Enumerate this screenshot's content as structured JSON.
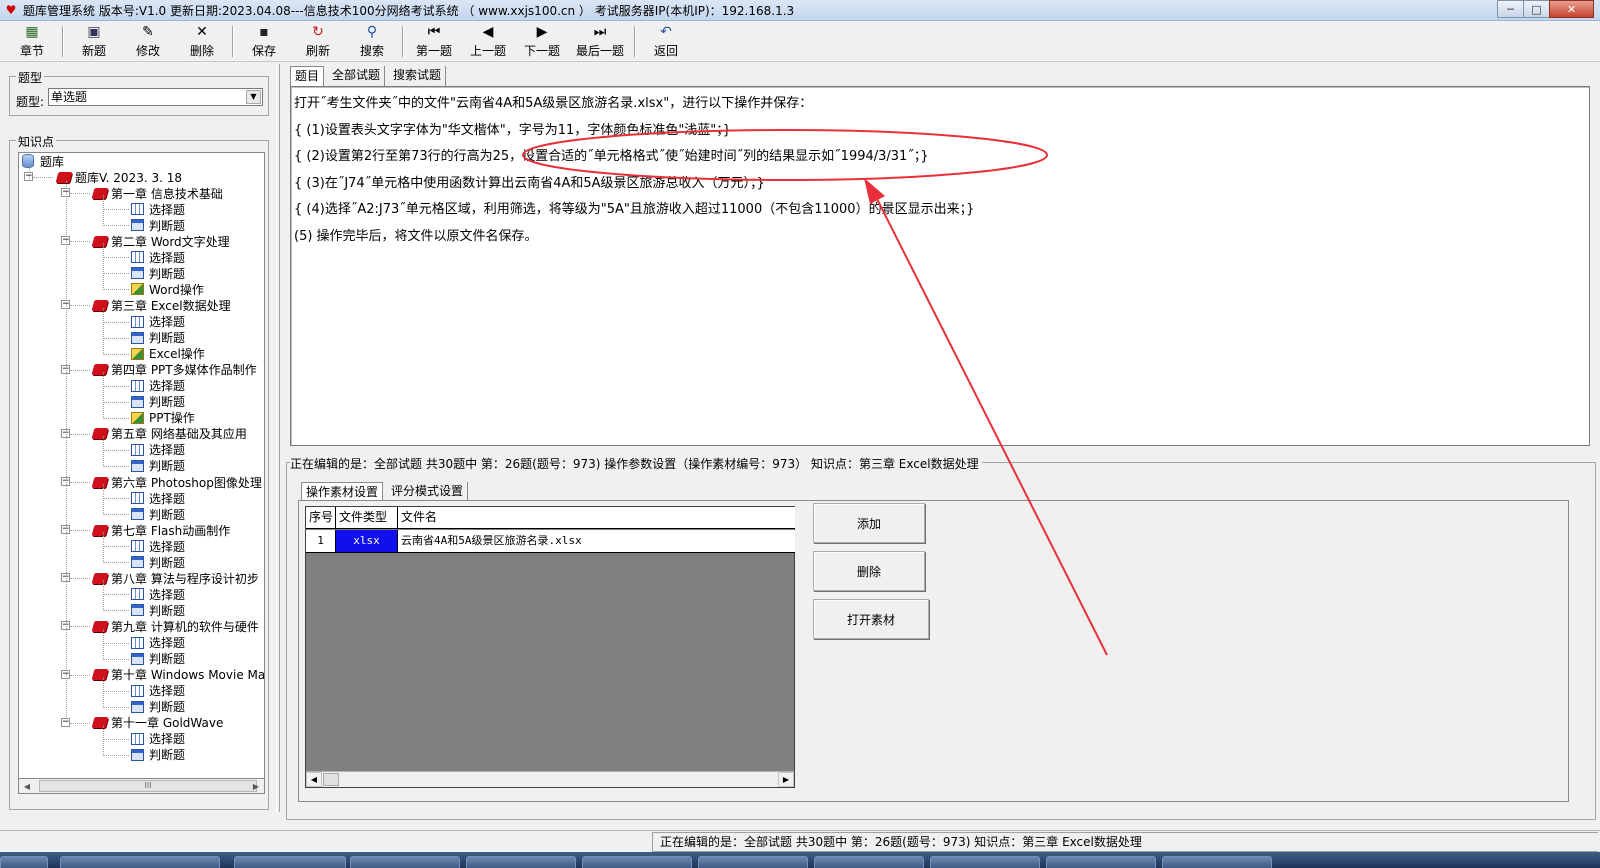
{
  "window": {
    "title": "题库管理系统 版本号:V1.0 更新日期:2023.04.08---信息技术100分网络考试系统  （ www.xxjs100.cn ）   考试服务器IP(本机IP)：192.168.1.3",
    "controls": {
      "minimize": "─",
      "maximize": "□",
      "close": "✕"
    }
  },
  "toolbar": [
    {
      "label": "章节",
      "icon": "chapter-icon"
    },
    {
      "label": "新题",
      "icon": "new-icon"
    },
    {
      "label": "修改",
      "icon": "edit-icon"
    },
    {
      "label": "删除",
      "icon": "delete-icon"
    },
    {
      "label": "保存",
      "icon": "save-icon"
    },
    {
      "label": "刷新",
      "icon": "refresh-icon"
    },
    {
      "label": "搜索",
      "icon": "search-icon"
    },
    {
      "label": "第一题",
      "icon": "first-icon"
    },
    {
      "label": "上一题",
      "icon": "prev-icon"
    },
    {
      "label": "下一题",
      "icon": "next-icon"
    },
    {
      "label": "最后一题",
      "icon": "last-icon"
    },
    {
      "label": "返回",
      "icon": "back-icon"
    }
  ],
  "left": {
    "type_group_title": "题型",
    "type_label": "题型:",
    "type_value": "单选题",
    "knowledge_group_title": "知识点",
    "tree": {
      "root": "题库",
      "db": "题库V. 2023. 3. 18",
      "chapters": [
        {
          "name": "第一章 信息技术基础",
          "children": [
            "选择题",
            "判断题"
          ]
        },
        {
          "name": "第二章 Word文字处理",
          "children": [
            "选择题",
            "判断题",
            "Word操作"
          ]
        },
        {
          "name": "第三章 Excel数据处理",
          "children": [
            "选择题",
            "判断题",
            "Excel操作"
          ]
        },
        {
          "name": "第四章 PPT多媒体作品制作",
          "children": [
            "选择题",
            "判断题",
            "PPT操作"
          ]
        },
        {
          "name": "第五章 网络基础及其应用",
          "children": [
            "选择题",
            "判断题"
          ]
        },
        {
          "name": "第六章 Photoshop图像处理",
          "children": [
            "选择题",
            "判断题"
          ]
        },
        {
          "name": "第七章 Flash动画制作",
          "children": [
            "选择题",
            "判断题"
          ]
        },
        {
          "name": "第八章 算法与程序设计初步",
          "children": [
            "选择题",
            "判断题"
          ]
        },
        {
          "name": "第九章 计算机的软件与硬件",
          "children": [
            "选择题",
            "判断题"
          ]
        },
        {
          "name": "第十章 Windows Movie Make",
          "children": [
            "选择题",
            "判断题"
          ]
        },
        {
          "name": "第十一章 GoldWave",
          "children": [
            "选择题",
            "判断题"
          ]
        }
      ]
    },
    "hscroll_thumb": "III"
  },
  "tabs": [
    "题目",
    "全部试题",
    "搜索试题"
  ],
  "question": {
    "lines": [
      "打开˝考生文件夹˝中的文件\"云南省4A和5A级景区旅游名录.xlsx\"，进行以下操作并保存：",
      "{ (1)设置表头文字字体为\"华文楷体\"，字号为11，字体颜色标准色\"浅蓝\"；}",
      "{ (2)设置第2行至第73行的行高为25，设置合适的˝单元格格式˝使˝始建时间˝列的结果显示如˝1994/3/31˝；}",
      "{ (3)在˝J74˝单元格中使用函数计算出云南省4A和5A级景区旅游总收入（万元）；}",
      "{ (4)选择˝A2:J73˝单元格区域，利用筛选，将等级为\"5A\"且旅游收入超过11000（不包含11000）的景区显示出来；}",
      "(5) 操作完毕后，将文件以原文件名保存。"
    ]
  },
  "edit_status": "正在编辑的是：全部试题 共30题中  第：26题(题号：973) 操作参数设置（操作素材编号：973） 知识点：第三章 Excel数据处理",
  "inner_tabs": [
    "操作素材设置",
    "评分模式设置"
  ],
  "grid": {
    "columns": [
      "序号",
      "文件类型",
      "文件名"
    ],
    "rows": [
      {
        "no": "1",
        "type": "xlsx",
        "name": "云南省4A和5A级景区旅游名录.xlsx"
      }
    ]
  },
  "buttons": {
    "add": "添加",
    "delete": "删除",
    "open": "打开素材"
  },
  "statusbar": "正在编辑的是：全部试题 共30题中  第：26题(题号：973)  知识点：第三章 Excel数据处理",
  "colors": {
    "annotation": "#e8303a",
    "file_type_bg": "#1010ee",
    "book": "#d0101a"
  }
}
